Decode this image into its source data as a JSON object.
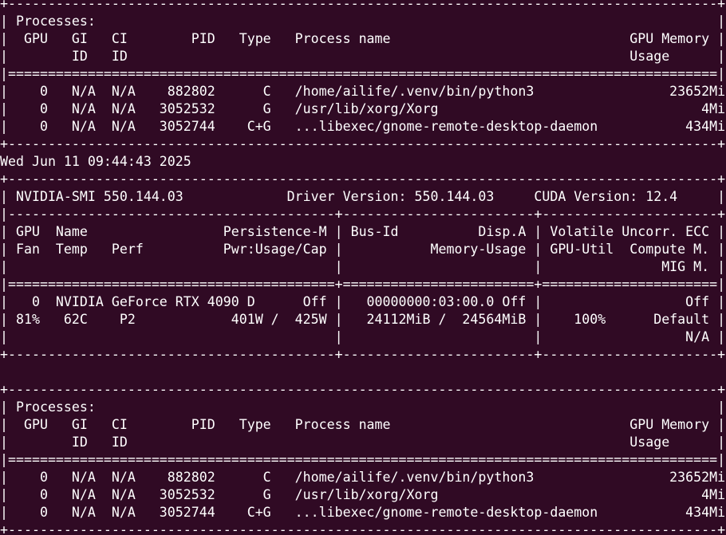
{
  "terminal": {
    "background": "#300a24",
    "foreground": "#ffffff",
    "lines": [
      "+-----------------------------------------------------------------------------------------+",
      "| Processes:                                                                              |",
      "|  GPU   GI   CI        PID   Type   Process name                              GPU Memory |",
      "|        ID   ID                                                               Usage      |",
      "|=========================================================================================|",
      "|    0   N/A  N/A    882802      C   /home/ailife/.venv/bin/python3                 23652MiB |",
      "|    0   N/A  N/A   3052532      G   /usr/lib/xorg/Xorg                                 4MiB |",
      "|    0   N/A  N/A   3052744    C+G   ...libexec/gnome-remote-desktop-daemon           434MiB |",
      "+-----------------------------------------------------------------------------------------+",
      "Wed Jun 11 09:44:43 2025",
      "+-----------------------------------------------------------------------------------------+",
      "| NVIDIA-SMI 550.144.03             Driver Version: 550.144.03     CUDA Version: 12.4     |",
      "|-----------------------------------------+------------------------+----------------------+",
      "| GPU  Name                 Persistence-M | Bus-Id          Disp.A | Volatile Uncorr. ECC |",
      "| Fan  Temp   Perf          Pwr:Usage/Cap |           Memory-Usage | GPU-Util  Compute M. |",
      "|                                         |                        |               MIG M. |",
      "|=========================================+========================+======================|",
      "|   0  NVIDIA GeForce RTX 4090 D      Off |   00000000:03:00.0 Off |                  Off |",
      "| 81%   62C    P2            401W /  425W |   24112MiB /  24564MiB |    100%      Default |",
      "|                                         |                        |                  N/A |",
      "+-----------------------------------------+------------------------+----------------------+",
      "",
      "+-----------------------------------------------------------------------------------------+",
      "| Processes:                                                                              |",
      "|  GPU   GI   CI        PID   Type   Process name                              GPU Memory |",
      "|        ID   ID                                                               Usage      |",
      "|=========================================================================================|",
      "|    0   N/A  N/A    882802      C   /home/ailife/.venv/bin/python3                 23652MiB |",
      "|    0   N/A  N/A   3052532      G   /usr/lib/xorg/Xorg                                 4MiB |",
      "|    0   N/A  N/A   3052744    C+G   ...libexec/gnome-remote-desktop-daemon           434MiB |",
      "+-----------------------------------------------------------------------------------------+"
    ]
  }
}
